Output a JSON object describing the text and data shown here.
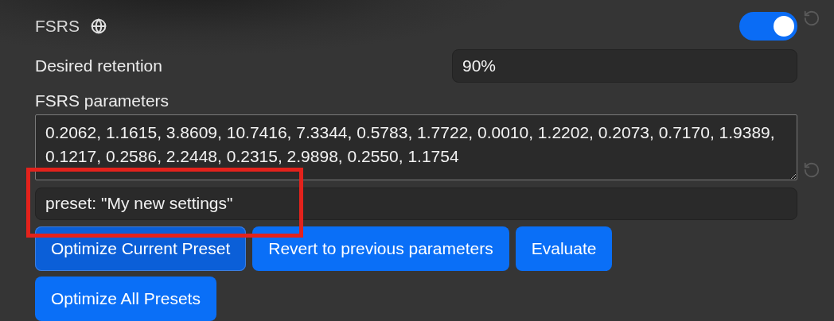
{
  "fsrs": {
    "label": "FSRS",
    "on": true
  },
  "desired_retention": {
    "label": "Desired retention",
    "value": "90%"
  },
  "parameters": {
    "label": "FSRS parameters",
    "value": "0.2062, 1.1615, 3.8609, 10.7416, 7.3344, 0.5783, 1.7722, 0.0010, 1.2202, 0.2073, 0.7170, 1.9389, 0.1217, 0.2586, 2.2448, 0.2315, 2.9898, 0.2550, 1.1754"
  },
  "preset_search": {
    "value": "preset: \"My new settings\""
  },
  "buttons": [
    {
      "label": "Optimize Current Preset",
      "focused": true
    },
    {
      "label": "Revert to previous parameters",
      "focused": false
    },
    {
      "label": "Evaluate",
      "focused": false
    },
    {
      "label": "Optimize All Presets",
      "focused": false
    }
  ],
  "annotation": {
    "kind": "rectangle",
    "color": "#e3221c"
  }
}
